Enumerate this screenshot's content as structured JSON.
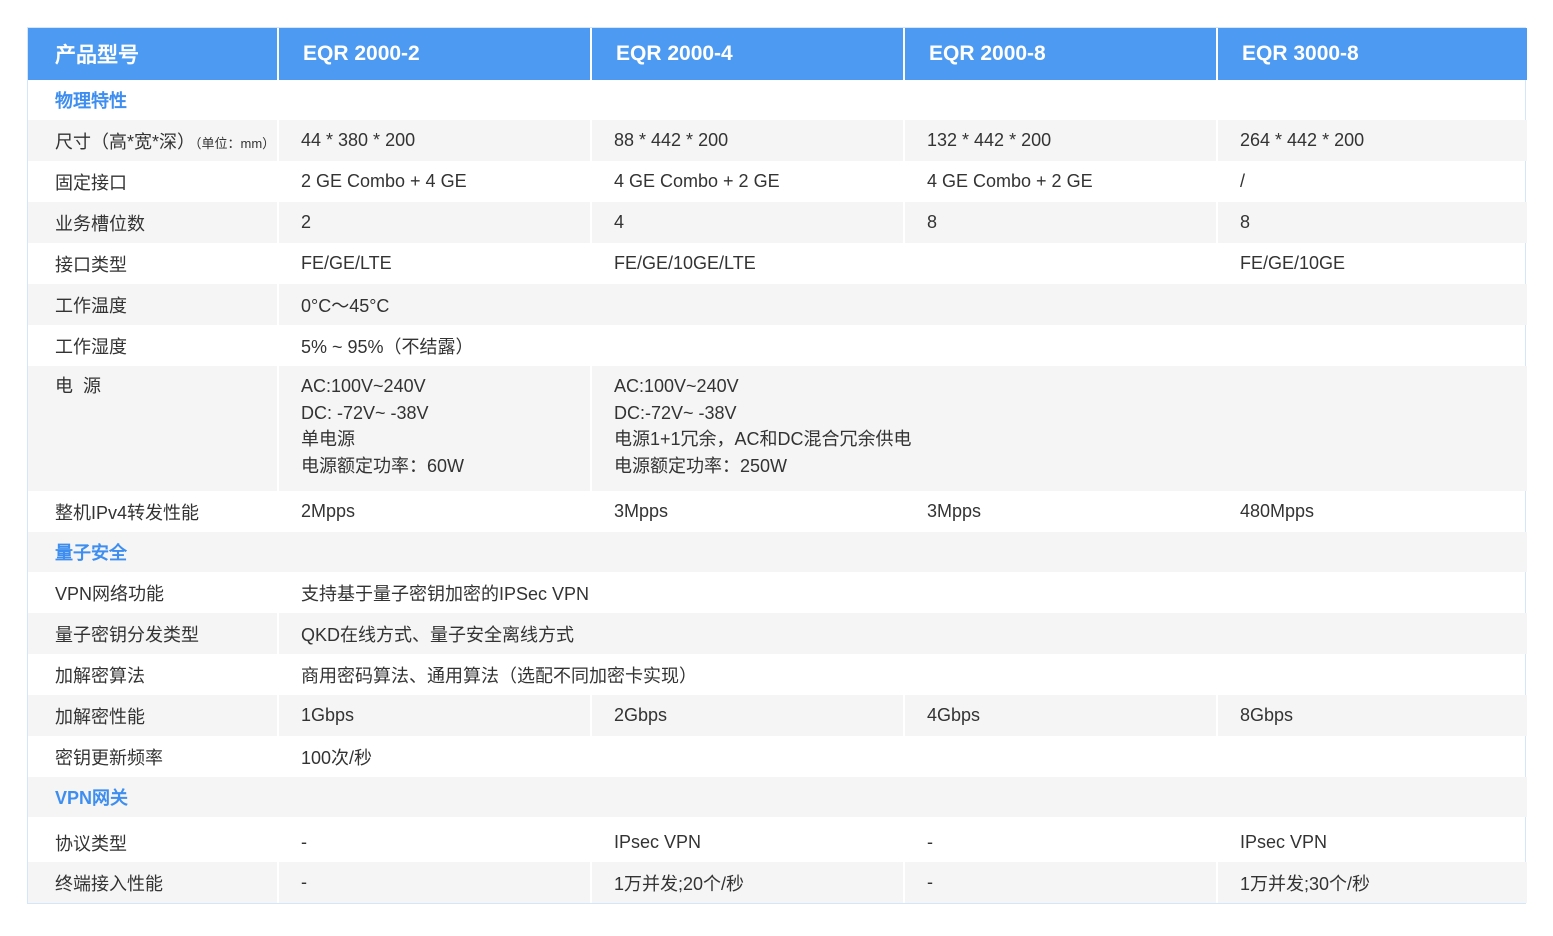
{
  "header": {
    "label": "产品型号",
    "models": [
      "EQR 2000-2",
      "EQR 2000-4",
      "EQR 2000-8",
      "EQR 3000-8"
    ]
  },
  "sections": {
    "physical": "物理特性",
    "quantum": "量子安全",
    "vpn": "VPN网关"
  },
  "rows": {
    "size": {
      "label": "尺寸（高*宽*深）",
      "unit": "（单位：mm）",
      "v": [
        "44 * 380 * 200",
        "88 * 442 * 200",
        "132 * 442 * 200",
        "264 * 442 * 200"
      ]
    },
    "fixed_ports": {
      "label": "固定接口",
      "v": [
        "2 GE Combo + 4 GE",
        "4 GE Combo + 2 GE",
        "4 GE Combo + 2 GE",
        "/"
      ]
    },
    "slots": {
      "label": "业务槽位数",
      "v": [
        "2",
        "4",
        "8",
        "8"
      ]
    },
    "port_types": {
      "label": "接口类型",
      "v": [
        "FE/GE/LTE",
        "FE/GE/10GE/LTE",
        "FE/GE/10GE"
      ]
    },
    "work_temp": {
      "label": "工作温度",
      "v": "0°C～45°C"
    },
    "work_humidity": {
      "label": "工作湿度",
      "v": "5% ~ 95%（不结露）"
    },
    "power": {
      "label": "电  源",
      "a": [
        "AC:100V~240V",
        "DC: -72V~ -38V",
        "单电源",
        "电源额定功率：60W"
      ],
      "b": [
        "AC:100V~240V",
        "DC:-72V~ -38V",
        "电源1+1冗余，AC和DC混合冗余供电",
        "电源额定功率：250W"
      ]
    },
    "ipv4": {
      "label": "整机IPv4转发性能",
      "v": [
        "2Mpps",
        "3Mpps",
        "3Mpps",
        "480Mpps"
      ]
    },
    "vpn_func": {
      "label": "VPN网络功能",
      "v": "支持基于量子密钥加密的IPSec VPN"
    },
    "qkd_type": {
      "label": "量子密钥分发类型",
      "v": "QKD在线方式、量子安全离线方式"
    },
    "crypto_algo": {
      "label": "加解密算法",
      "v": "商用密码算法、通用算法（选配不同加密卡实现）"
    },
    "crypto_perf": {
      "label": "加解密性能",
      "v": [
        "1Gbps",
        "2Gbps",
        "4Gbps",
        "8Gbps"
      ]
    },
    "key_rate": {
      "label": "密钥更新频率",
      "v": "100次/秒"
    },
    "protocol": {
      "label": "协议类型",
      "v": [
        "-",
        "IPsec VPN",
        "-",
        "IPsec VPN"
      ]
    },
    "terminal": {
      "label": "终端接入性能",
      "v": [
        "-",
        "1万并发;20个/秒",
        "-",
        "1万并发;30个/秒"
      ]
    }
  },
  "colors": {
    "header_bg": "#4d9af2",
    "section_text": "#3d8ef0",
    "stripe": "#f5f5f5",
    "border": "#d6e6fa"
  }
}
